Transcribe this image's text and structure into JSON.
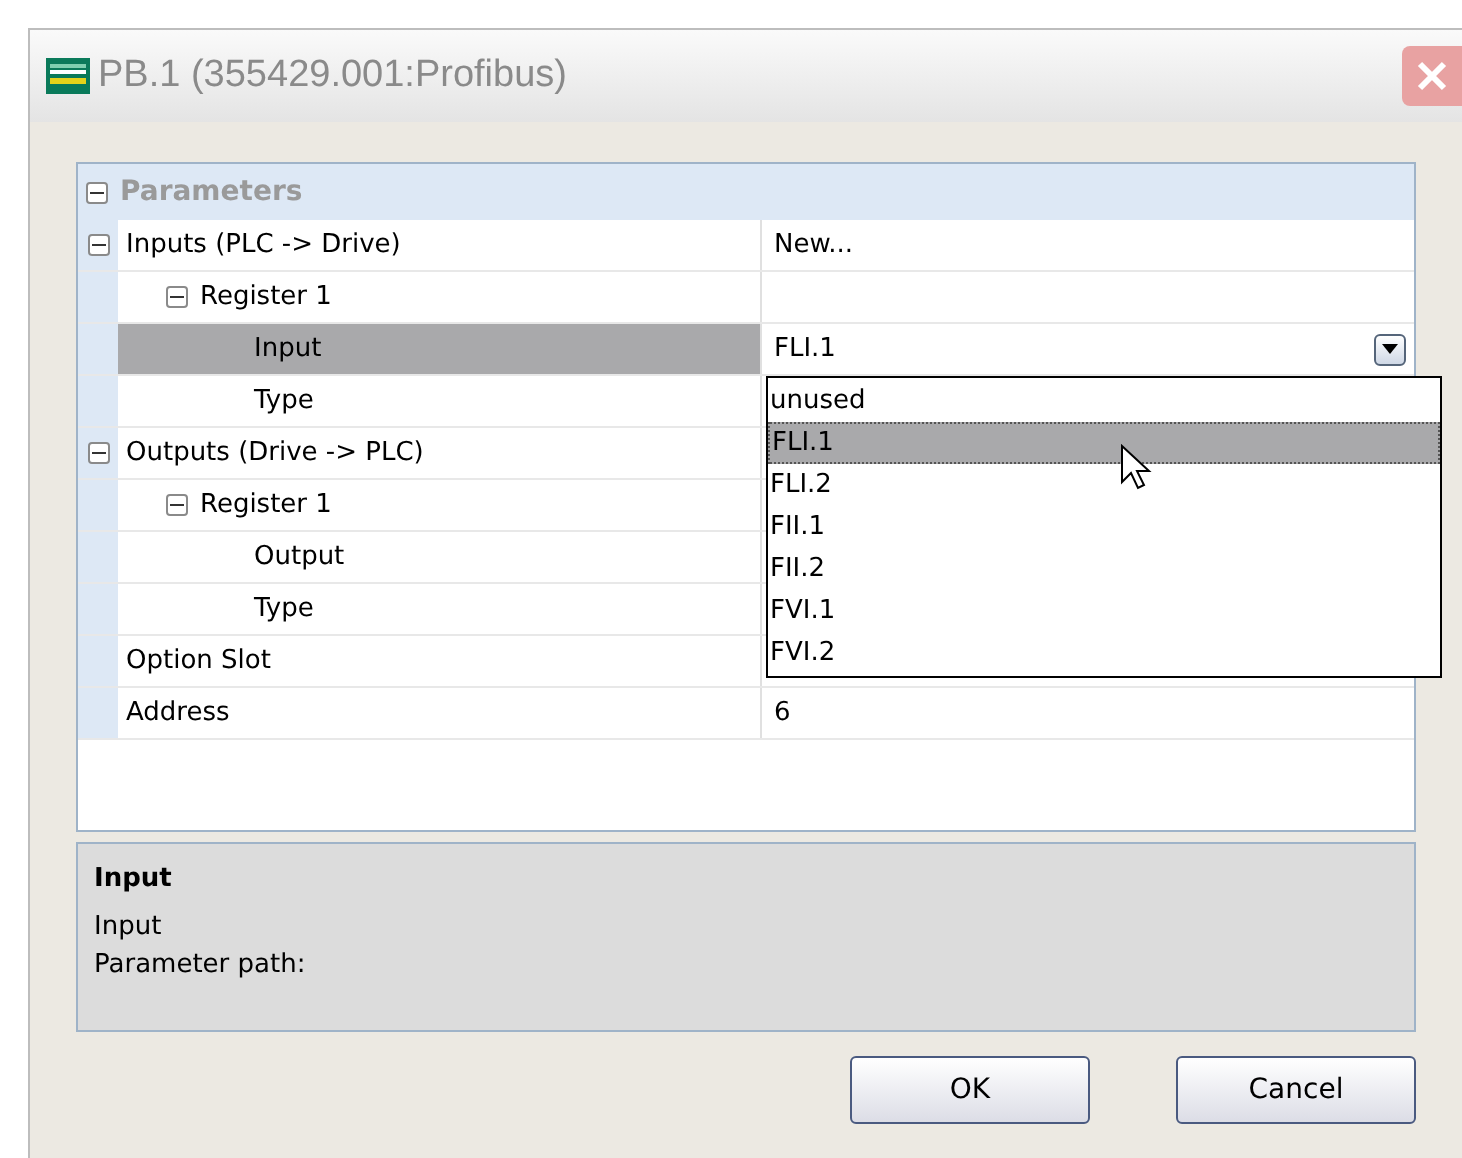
{
  "window": {
    "title": "PB.1 (355429.001:Profibus)"
  },
  "grid": {
    "category": {
      "label": "Parameters",
      "expanded": true
    },
    "rows": [
      {
        "label": "Inputs (PLC -> Drive)",
        "value": "New...",
        "expanded": true,
        "selected": false,
        "children": [
          {
            "label": "Register 1",
            "expanded": true,
            "selected": false,
            "children": [
              {
                "label": "Input",
                "value": "FLI.1",
                "selected": true,
                "kind": "dropdown"
              },
              {
                "label": "Type",
                "selected": false
              }
            ]
          }
        ]
      },
      {
        "label": "Outputs (Drive -> PLC)",
        "expanded": true,
        "selected": false,
        "children": [
          {
            "label": "Register 1",
            "expanded": true,
            "selected": false,
            "children": [
              {
                "label": "Output",
                "selected": false
              },
              {
                "label": "Type",
                "selected": false
              }
            ]
          }
        ]
      },
      {
        "label": "Option Slot",
        "selected": false
      },
      {
        "label": "Address",
        "value": "6",
        "selected": false
      }
    ]
  },
  "dropdown_list": [
    {
      "label": "unused",
      "selected": false
    },
    {
      "label": "FLI.1",
      "selected": true
    },
    {
      "label": "FLI.2",
      "selected": false
    },
    {
      "label": "FII.1",
      "selected": false
    },
    {
      "label": "FII.2",
      "selected": false
    },
    {
      "label": "FVI.1",
      "selected": false
    },
    {
      "label": "FVI.2",
      "selected": false
    }
  ],
  "description": {
    "title": "Input",
    "text": "Input",
    "path_label": "Parameter path:"
  },
  "buttons": [
    "OK",
    "Cancel"
  ]
}
